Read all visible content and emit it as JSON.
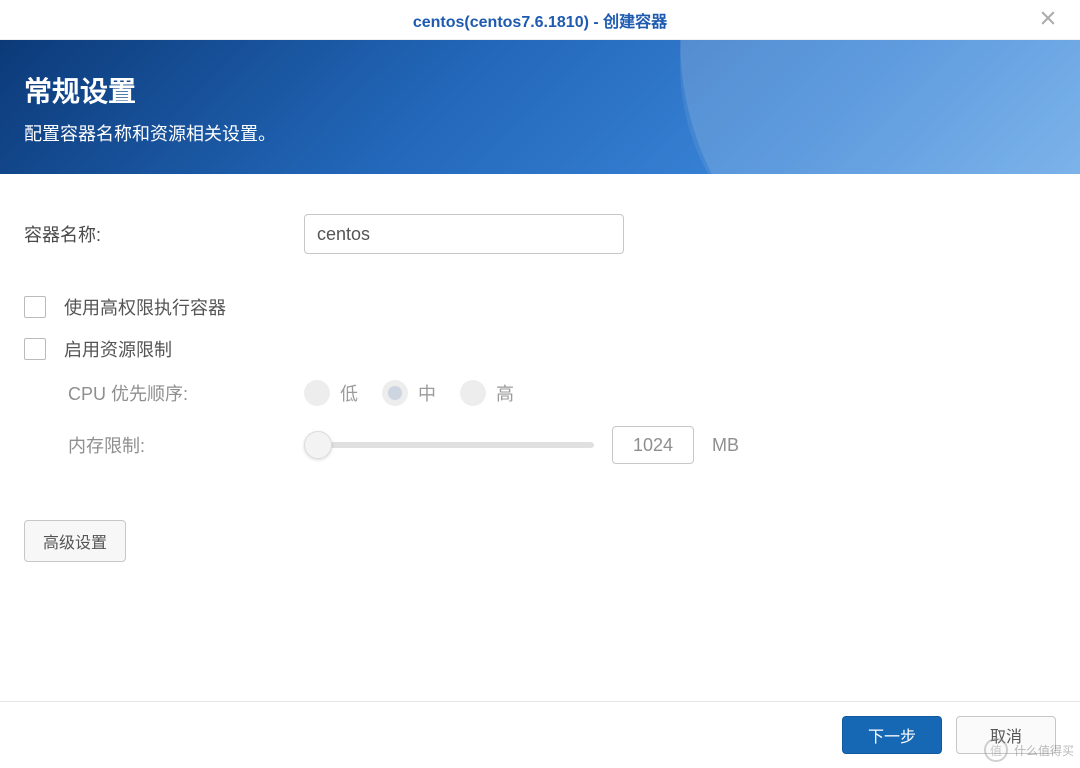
{
  "titlebar": {
    "title": "centos(centos7.6.1810) - 创建容器"
  },
  "banner": {
    "heading": "常规设置",
    "subheading": "配置容器名称和资源相关设置。"
  },
  "form": {
    "container_name_label": "容器名称:",
    "container_name_value": "centos",
    "high_privilege_label": "使用高权限执行容器",
    "enable_resource_limit_label": "启用资源限制",
    "cpu_priority_label": "CPU 优先顺序:",
    "cpu_options": {
      "low": "低",
      "mid": "中",
      "high": "高"
    },
    "cpu_selected": "mid",
    "memory_limit_label": "内存限制:",
    "memory_value": "1024",
    "memory_unit": "MB",
    "advanced_button": "高级设置"
  },
  "footer": {
    "next": "下一步",
    "cancel": "取消"
  },
  "watermark": {
    "badge": "值",
    "text": "什么值得买"
  }
}
